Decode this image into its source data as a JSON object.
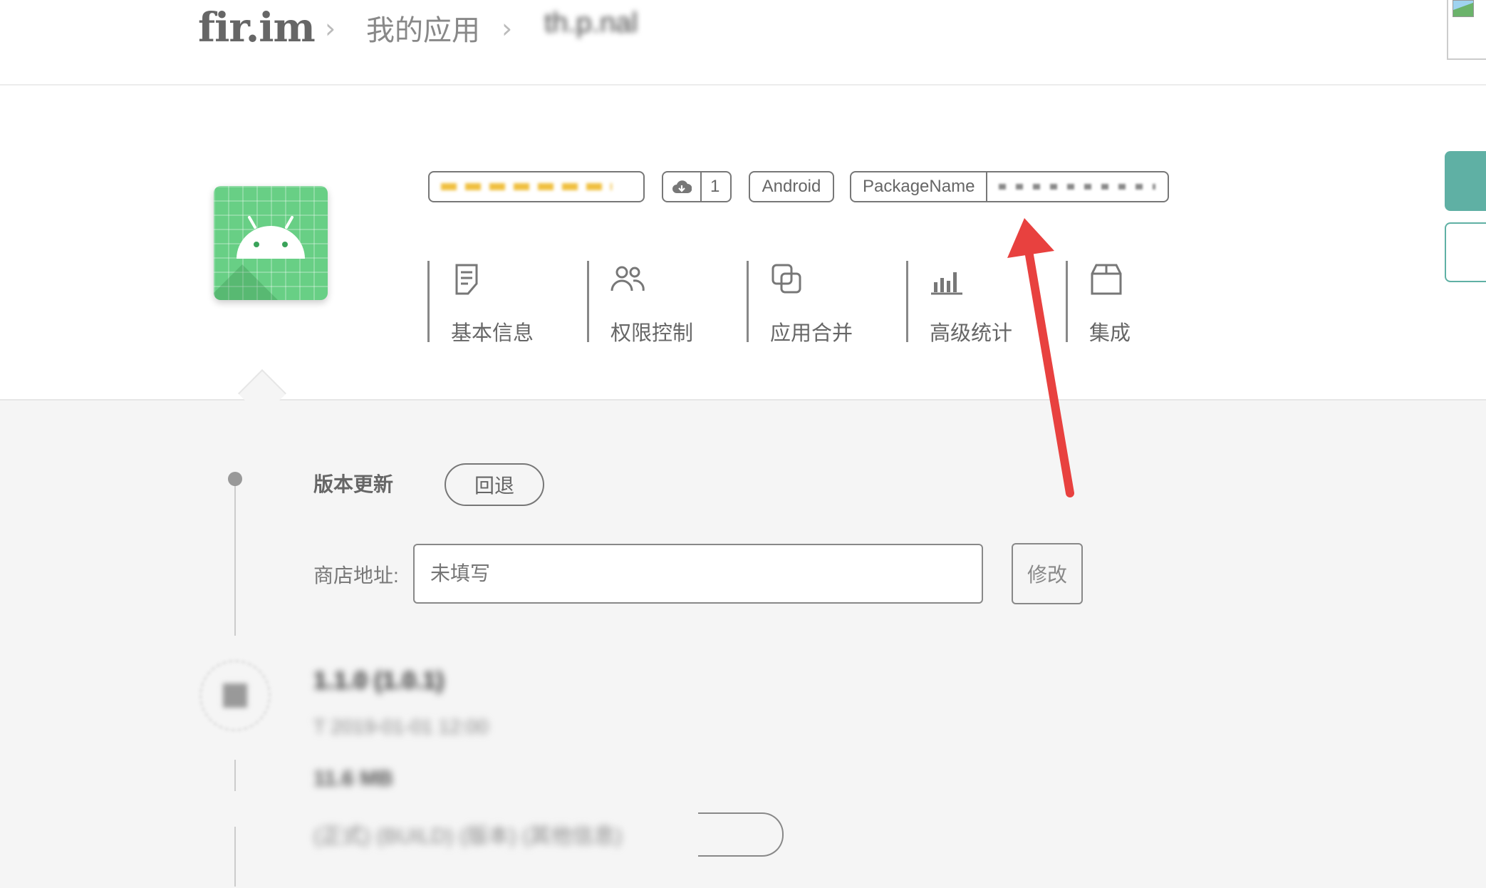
{
  "header": {
    "logo": "fir.im",
    "breadcrumb_sep": "›",
    "breadcrumb_my_apps": "我的应用",
    "breadcrumb_current": "th.p.nal"
  },
  "app": {
    "name_tag": "ti.p.nd.bb.p.rg.ep",
    "download_count": "1",
    "platform": "Android",
    "package_label": "PackageName",
    "package_value": "c.om.xx.p.xxx.x"
  },
  "nav": [
    {
      "label": "基本信息",
      "icon": "document-icon"
    },
    {
      "label": "权限控制",
      "icon": "users-icon"
    },
    {
      "label": "应用合并",
      "icon": "merge-icon"
    },
    {
      "label": "高级统计",
      "icon": "bar-chart-icon"
    },
    {
      "label": "集成",
      "icon": "box-icon"
    }
  ],
  "update": {
    "section_label": "版本更新",
    "rollback_button": "回退",
    "store_label": "商店地址:",
    "store_placeholder": "未填写",
    "edit_button": "修改"
  },
  "version": {
    "title": "1.1.0 (1.0.1)",
    "date": "T 2019-01-01 12:00",
    "size": "11.6 MB",
    "tags": "(正式) (BUILD) (版本) (其他信息)"
  },
  "colors": {
    "accent": "#5fb0a4",
    "arrow": "#e8413f",
    "android_green": "#68cf85"
  }
}
